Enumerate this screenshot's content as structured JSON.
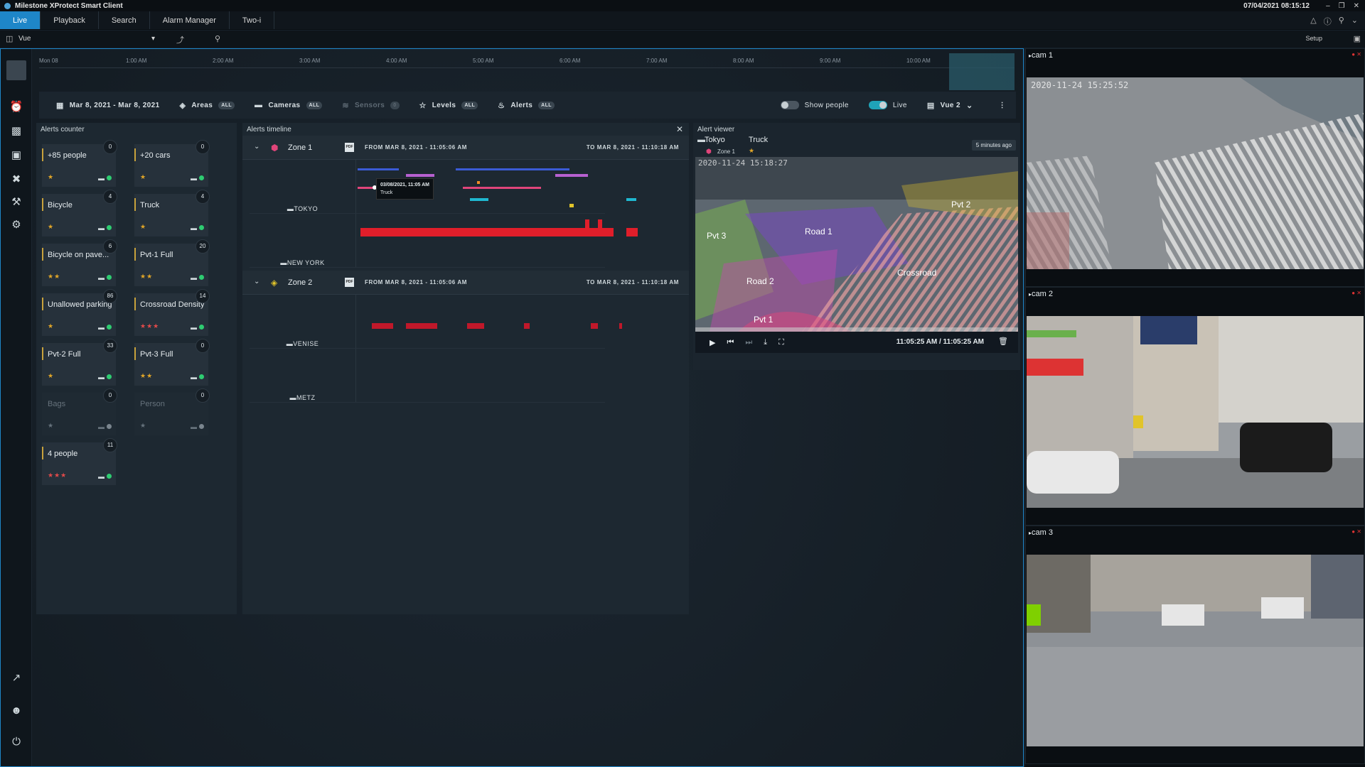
{
  "app": {
    "title": "Milestone XProtect Smart Client",
    "clock": "07/04/2021 08:15:12",
    "window_buttons": [
      "–",
      "❐",
      "✕"
    ]
  },
  "tabs": [
    {
      "label": "Live",
      "active": true
    },
    {
      "label": "Playback",
      "active": false
    },
    {
      "label": "Search",
      "active": false
    },
    {
      "label": "Alarm Manager",
      "active": false
    },
    {
      "label": "Two-i",
      "active": false
    }
  ],
  "viewbar": {
    "view": "Vue",
    "setup": "Setup"
  },
  "ruler": {
    "ticks": [
      "Mon 08",
      "1:00 AM",
      "2:00 AM",
      "3:00 AM",
      "4:00 AM",
      "5:00 AM",
      "6:00 AM",
      "7:00 AM",
      "8:00 AM",
      "9:00 AM",
      "10:00 AM"
    ]
  },
  "filters": {
    "date": "Mar 8, 2021  -  Mar 8, 2021",
    "areas": {
      "label": "Areas",
      "pill": "ALL"
    },
    "cameras": {
      "label": "Cameras",
      "pill": "ALL"
    },
    "sensors": {
      "label": "Sensors",
      "pill": "0"
    },
    "levels": {
      "label": "Levels",
      "pill": "ALL"
    },
    "alerts": {
      "label": "Alerts",
      "pill": "ALL"
    },
    "show_people": "Show people",
    "live": "Live",
    "vue": "Vue 2"
  },
  "alerts_counter": {
    "title": "Alerts counter",
    "cards": [
      {
        "title": "+85 people",
        "count": "0",
        "stars": "★",
        "star_color": "#e1a628",
        "active": true
      },
      {
        "title": "+20 cars",
        "count": "0",
        "stars": "★",
        "star_color": "#e1a628",
        "active": true
      },
      {
        "title": "Bicycle",
        "count": "4",
        "stars": "★",
        "star_color": "#e1a628",
        "active": true
      },
      {
        "title": "Truck",
        "count": "4",
        "stars": "★",
        "star_color": "#e1a628",
        "active": true
      },
      {
        "title": "Bicycle on pave...",
        "count": "6",
        "stars": "★★",
        "star_color": "#e1a628",
        "active": true
      },
      {
        "title": "Pvt-1 Full",
        "count": "20",
        "stars": "★★",
        "star_color": "#e1a628",
        "active": true
      },
      {
        "title": "Unallowed parking",
        "count": "86",
        "stars": "★",
        "star_color": "#e1a628",
        "active": true
      },
      {
        "title": "Crossroad Density",
        "count": "14",
        "stars": "★★★",
        "star_color": "#e24a4a",
        "active": true
      },
      {
        "title": "Pvt-2 Full",
        "count": "33",
        "stars": "★",
        "star_color": "#e1a628",
        "active": true
      },
      {
        "title": "Pvt-3 Full",
        "count": "0",
        "stars": "★★",
        "star_color": "#e1a628",
        "active": true
      },
      {
        "title": "Bags",
        "count": "0",
        "stars": "★",
        "star_color": "#66727c",
        "active": false
      },
      {
        "title": "Person",
        "count": "0",
        "stars": "★",
        "star_color": "#66727c",
        "active": false
      },
      {
        "title": "4 people",
        "count": "11",
        "stars": "★★★",
        "star_color": "#e24a4a",
        "active": true
      }
    ]
  },
  "timeline": {
    "title": "Alerts timeline",
    "zones": [
      {
        "name": "Zone 1",
        "pdf": "PDF",
        "from": "FROM MAR 8, 2021 - 11:05:06 AM",
        "to": "TO MAR 8, 2021 - 11:10:18 AM",
        "cameras": [
          "TOKYO",
          "NEW YORK"
        ]
      },
      {
        "name": "Zone 2",
        "pdf": "PDF",
        "from": "FROM MAR 8, 2021 - 11:05:06 AM",
        "to": "TO MAR 8, 2021 - 11:10:18 AM",
        "cameras": [
          "VENISE",
          "METZ"
        ]
      }
    ],
    "tooltip": {
      "time": "03/08/2021, 11:05 AM",
      "label": "Truck"
    }
  },
  "viewer": {
    "title": "Alert viewer",
    "camera": "Tokyo",
    "object": "Truck",
    "zone": "Zone 1",
    "star": "★",
    "ago": "5 minutes ago",
    "overlay_stamp": "2020-11-24 15:18:27",
    "regions": [
      "Road 1",
      "Road 2",
      "Crossroad",
      "Pvt 1",
      "Pvt 2",
      "Pvt 3"
    ],
    "time": "11:05:25 AM / 11:05:25 AM"
  },
  "cameras": [
    {
      "label": "cam 1",
      "stamp": "2020-11-24 15:25:52"
    },
    {
      "label": "cam 2",
      "stamp": ""
    },
    {
      "label": "cam 3",
      "stamp": ""
    }
  ]
}
